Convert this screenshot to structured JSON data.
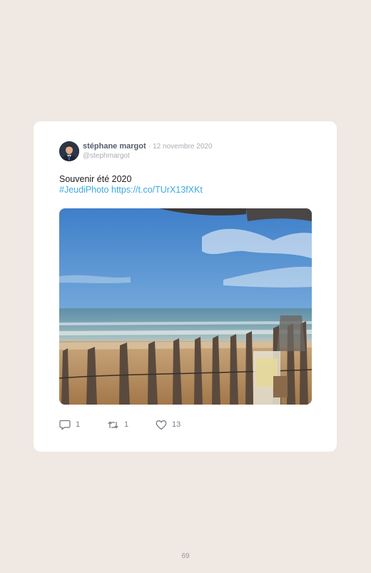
{
  "tweet": {
    "author_name": "stéphane margot",
    "separator": "·",
    "date": "12 novembre 2020",
    "handle": "@stephmargot",
    "text": "Souvenir été 2020",
    "hashtag": "#JeudiPhoto",
    "link": "https://t.co/TUrX13fXKt",
    "replies": "1",
    "retweets": "1",
    "likes": "13"
  },
  "icons": {
    "reply": "speech-bubble-icon",
    "retweet": "retweet-arrows-icon",
    "like": "heart-icon"
  },
  "colors": {
    "page_background": "#f0e8e3",
    "card_background": "#ffffff",
    "link": "#3ea9e5"
  },
  "page_number": "69"
}
